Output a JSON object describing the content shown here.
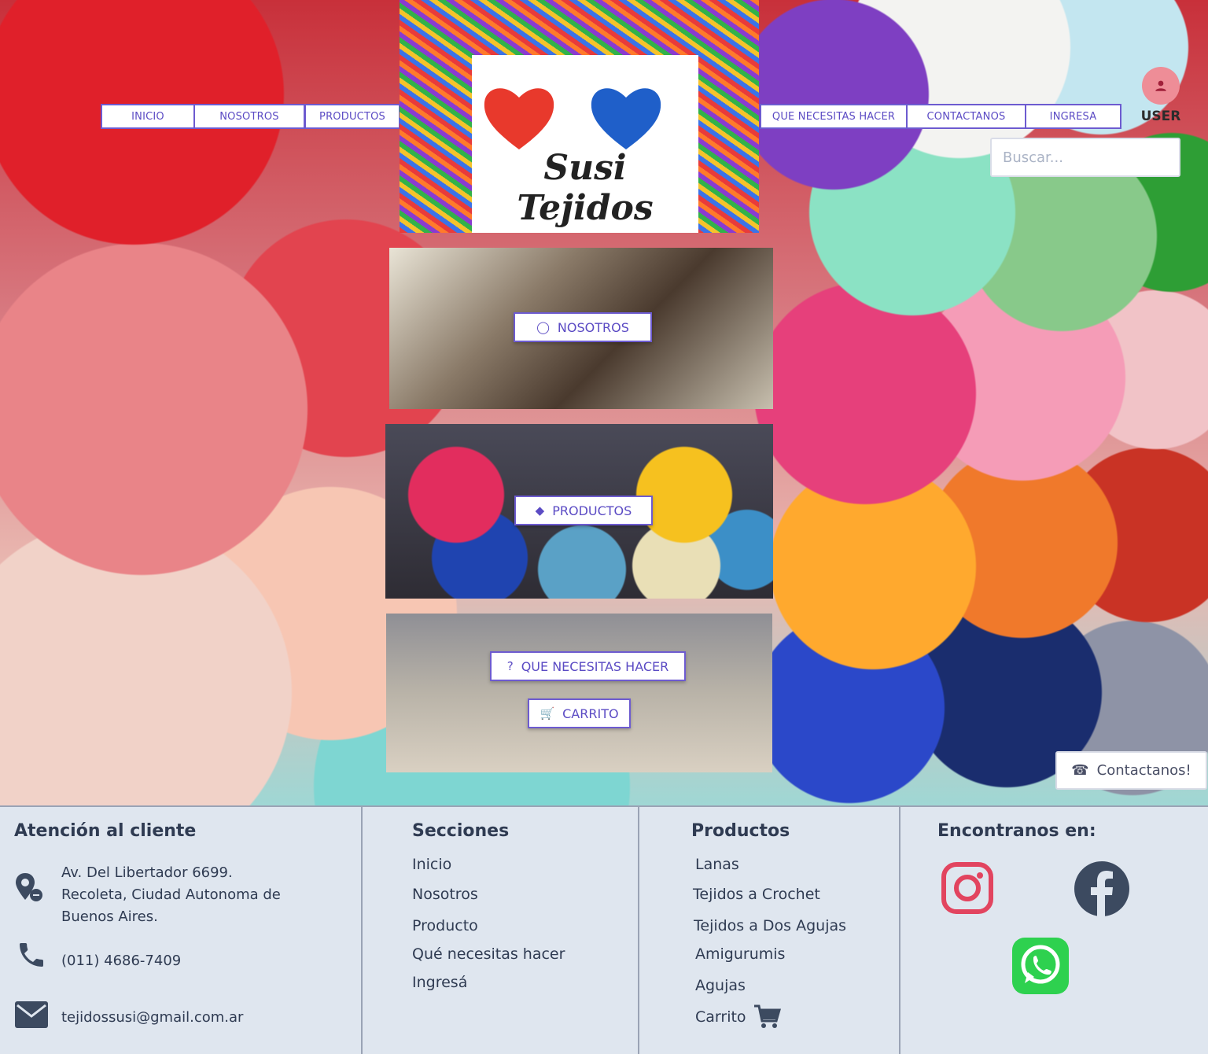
{
  "nav": {
    "inicio": "INICIO",
    "nosotros": "NOSOTROS",
    "productos": "PRODUCTOS",
    "que_necesitas": "QUE NECESITAS HACER",
    "contactanos": "CONTACTANOS",
    "ingresa": "INGRESA"
  },
  "logo": {
    "title": "Susi Tejidos"
  },
  "user": {
    "label": "USER"
  },
  "search": {
    "placeholder": "Buscar..."
  },
  "cards": {
    "nosotros": "NOSOTROS",
    "productos": "PRODUCTOS",
    "que_necesitas": "QUE NECESITAS HACER",
    "carrito": "CARRITO"
  },
  "contact_float": {
    "label": "Contactanos!"
  },
  "footer": {
    "atencion": {
      "title": "Atención al cliente",
      "address_lines": [
        "Av. Del Libertador 6699.",
        "Recoleta, Ciudad Autonoma de",
        "Buenos Aires."
      ],
      "phone": "(011) 4686-7409",
      "email": "tejidossusi@gmail.com.ar"
    },
    "secciones": {
      "title": "Secciones",
      "items": [
        "Inicio",
        "Nosotros",
        "Producto",
        "Qué necesitas hacer",
        "Ingresá"
      ]
    },
    "productos": {
      "title": "Productos",
      "items": [
        "Lanas",
        "Tejidos a Crochet",
        "Tejidos a Dos Agujas",
        "Amigurumis",
        "Agujas",
        "Carrito"
      ]
    },
    "social": {
      "title": "Encontranos en:"
    }
  },
  "colors": {
    "accent": "#5b4bc4",
    "footer_bg": "#dfe6ef",
    "footer_text": "#2f3b52"
  },
  "icons": [
    "user-icon",
    "lightbulb-icon",
    "tag-icon",
    "question-icon",
    "cart-icon",
    "phone-icon",
    "location-icon",
    "mail-icon",
    "instagram-icon",
    "facebook-icon",
    "whatsapp-icon"
  ]
}
